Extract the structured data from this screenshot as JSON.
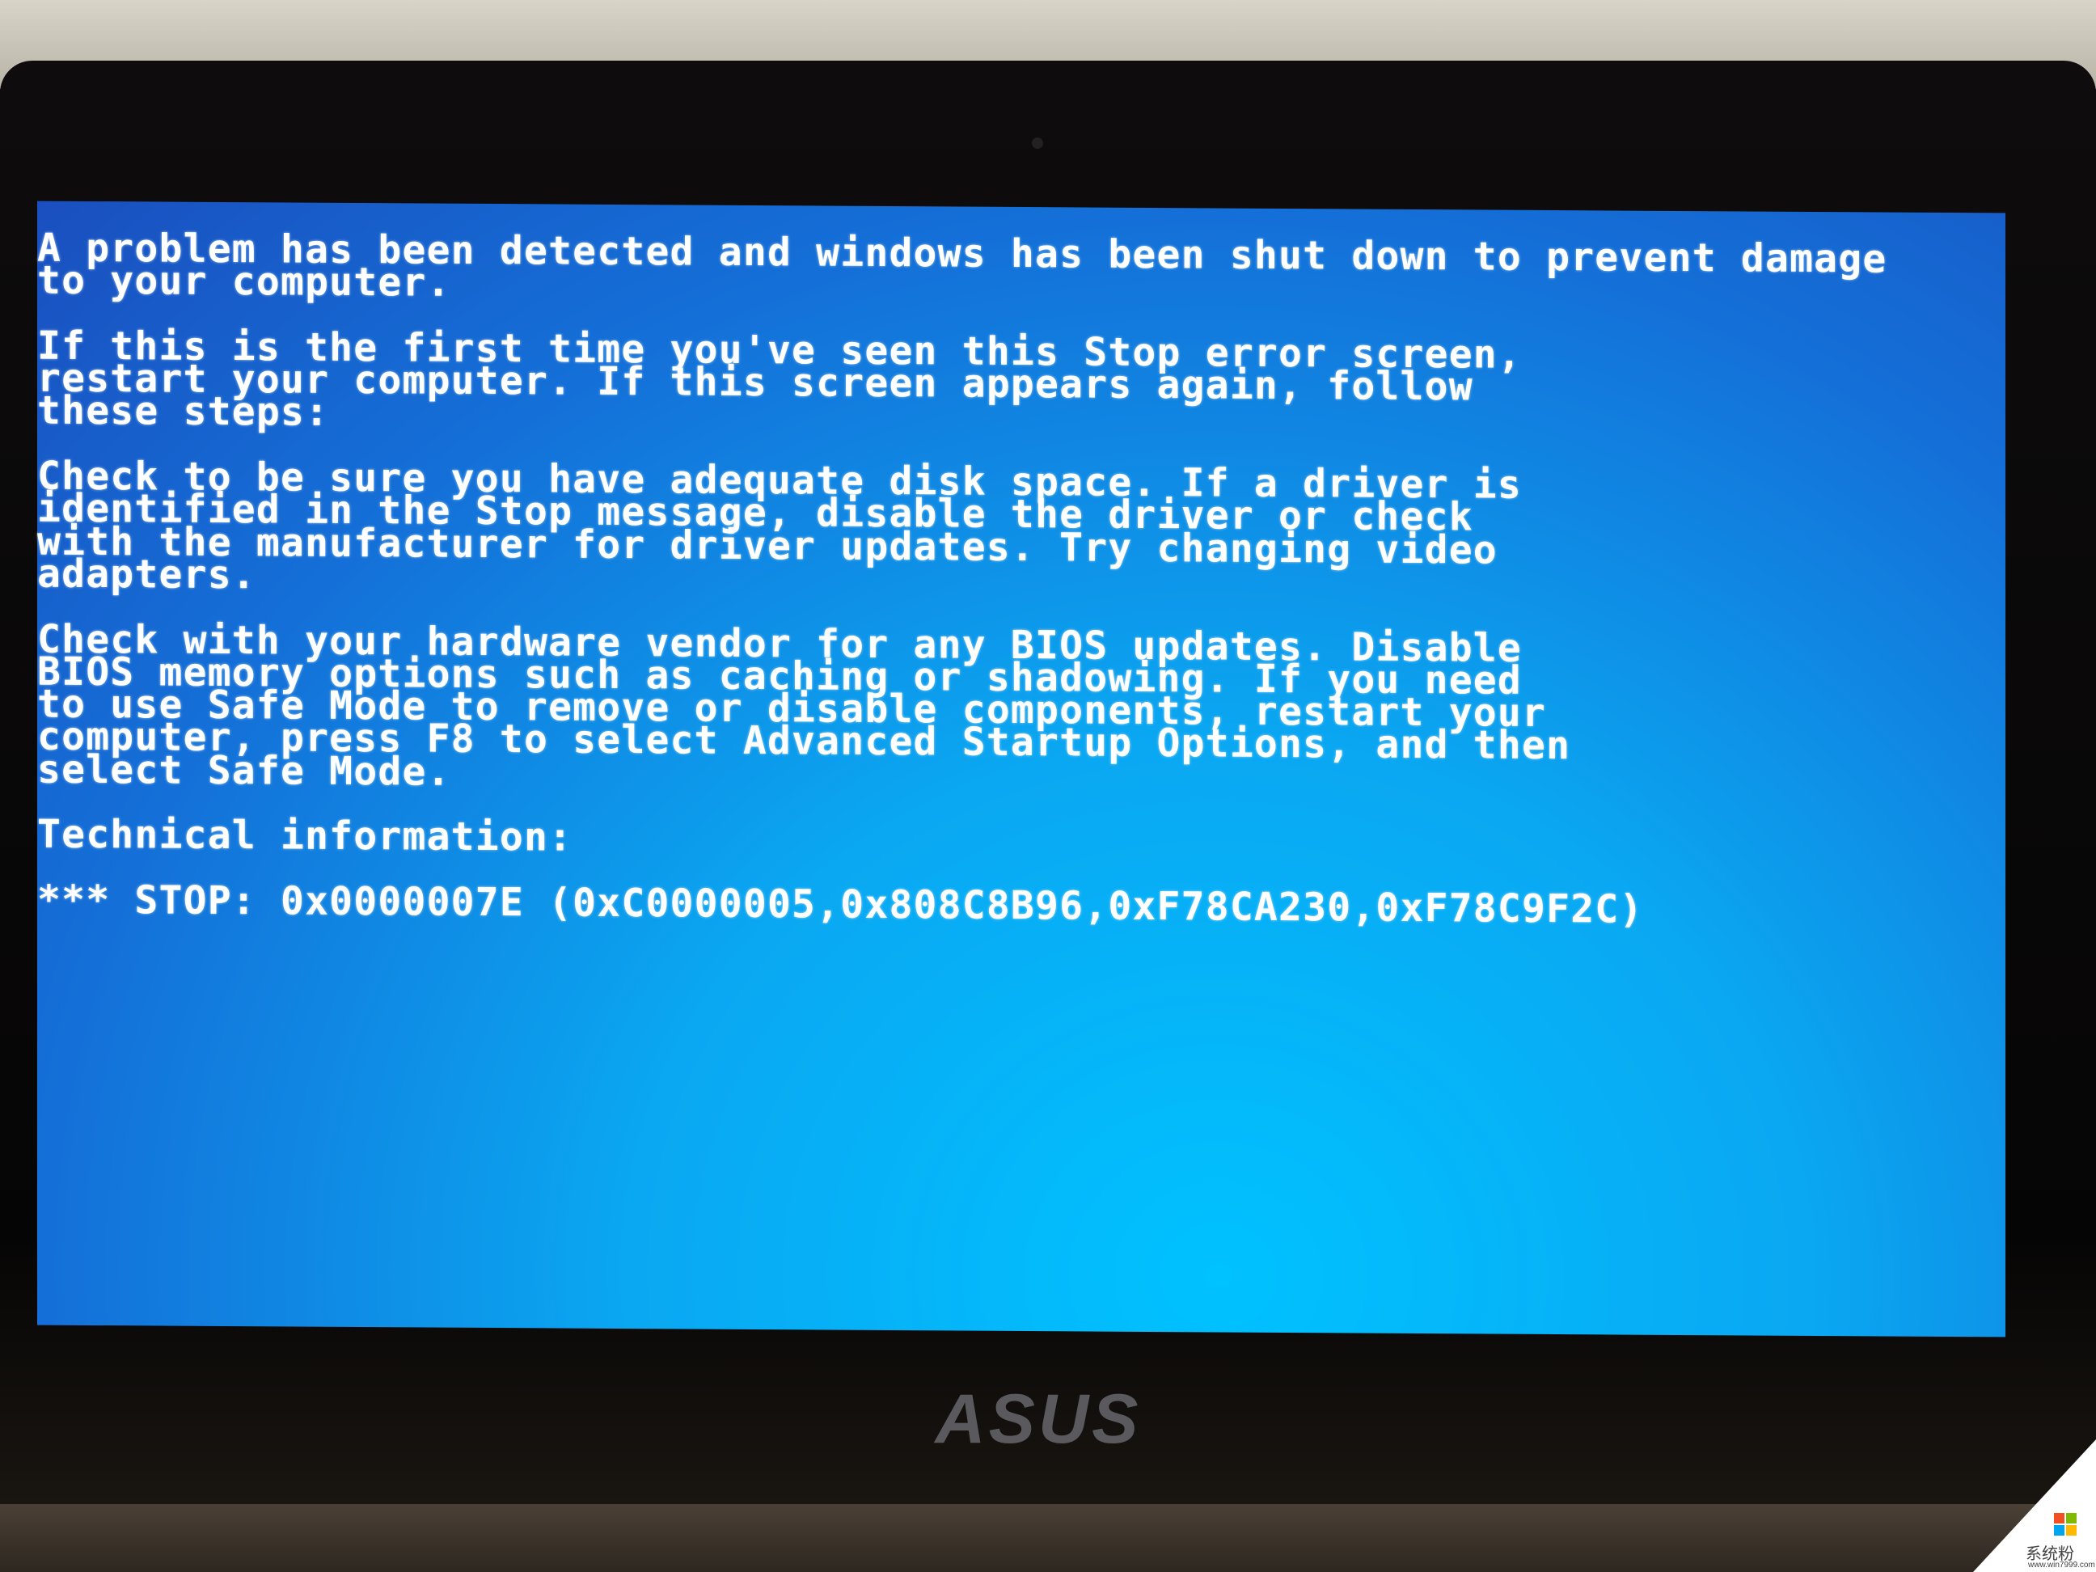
{
  "bsod": {
    "lines": [
      "A problem has been detected and windows has been shut down to prevent damage",
      "to your computer.",
      "",
      "If this is the first time you've seen this Stop error screen,",
      "restart your computer. If this screen appears again, follow",
      "these steps:",
      "",
      "Check to be sure you have adequate disk space. If a driver is",
      "identified in the Stop message, disable the driver or check",
      "with the manufacturer for driver updates. Try changing video",
      "adapters.",
      "",
      "Check with your hardware vendor for any BIOS updates. Disable",
      "BIOS memory options such as caching or shadowing. If you need",
      "to use Safe Mode to remove or disable components, restart your",
      "computer, press F8 to select Advanced Startup Options, and then",
      "select Safe Mode.",
      "",
      "Technical information:",
      "",
      "*** STOP: 0x0000007E (0xC0000005,0x808C8B96,0xF78CA230,0xF78C9F2C)"
    ],
    "background_color": "#1470d8",
    "text_color": "#ffffff"
  },
  "laptop": {
    "brand_logo": "ASUS"
  },
  "watermark": {
    "name": "系统粉",
    "url": "www.win7999.com",
    "icon": "windows-logo-icon"
  }
}
